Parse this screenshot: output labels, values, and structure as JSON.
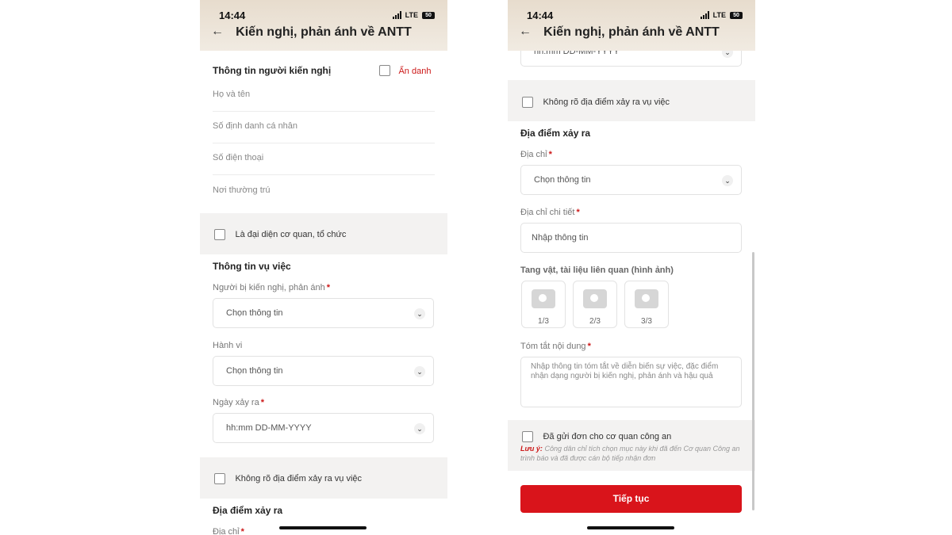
{
  "status": {
    "time": "14:44",
    "network": "LTE",
    "battery": "50"
  },
  "header": {
    "back_icon": "←",
    "title": "Kiến nghị, phản ánh về ANTT"
  },
  "left": {
    "petitioner_section": "Thông tin người kiến nghị",
    "anonymous_label": "Ẩn danh",
    "full_name_placeholder": "Họ và tên",
    "id_number_placeholder": "Số định danh cá nhân",
    "phone_placeholder": "Số điện thoại",
    "residence_placeholder": "Nơi thường trú",
    "org_rep_label": "Là đại diện cơ quan, tổ chức",
    "case_section": "Thông tin vụ việc",
    "accused_label": "Người bị kiến nghị, phản ánh",
    "accused_value": "Chọn thông tin",
    "behavior_label": "Hành vi",
    "behavior_value": "Chọn thông tin",
    "date_label": "Ngày xảy ra",
    "date_value": "hh:mm DD-MM-YYYY",
    "unknown_location_label": "Không rõ địa điểm xảy ra vụ việc",
    "location_section": "Địa điểm xảy ra",
    "address_label": "Địa chỉ"
  },
  "right": {
    "date_value": "hh:mm DD-MM-YYYY",
    "unknown_location_label": "Không rõ địa điểm xảy ra vụ việc",
    "location_section": "Địa điểm xảy ra",
    "address_label": "Địa chỉ",
    "address_value": "Chọn thông tin",
    "detail_address_label": "Địa chỉ chi tiết",
    "detail_address_placeholder": "Nhập thông tin",
    "evidence_label": "Tang vật, tài liệu liên quan (hình ảnh)",
    "photos": [
      "1/3",
      "2/3",
      "3/3"
    ],
    "summary_label": "Tóm tắt nội dung",
    "summary_placeholder": "Nhập thông tin tóm tắt về diễn biến sự việc, đặc điểm nhận dạng người bị kiến nghị, phản ánh và hậu quả",
    "sent_label": "Đã gửi đơn cho cơ quan công an",
    "note_prefix": "Lưu ý:",
    "note_text": "Công dân chỉ tích chọn mục này khi đã đến Cơ quan Công an trình báo và đã được cán bộ tiếp nhận đơn",
    "continue_button": "Tiếp tục"
  },
  "required_mark": "*",
  "icons": {
    "dropdown": "chevron-down-icon",
    "camera": "camera-icon"
  },
  "colors": {
    "accent": "#d9141b",
    "header_bg": "#ece4d8",
    "band_bg": "#f3f2f1"
  }
}
